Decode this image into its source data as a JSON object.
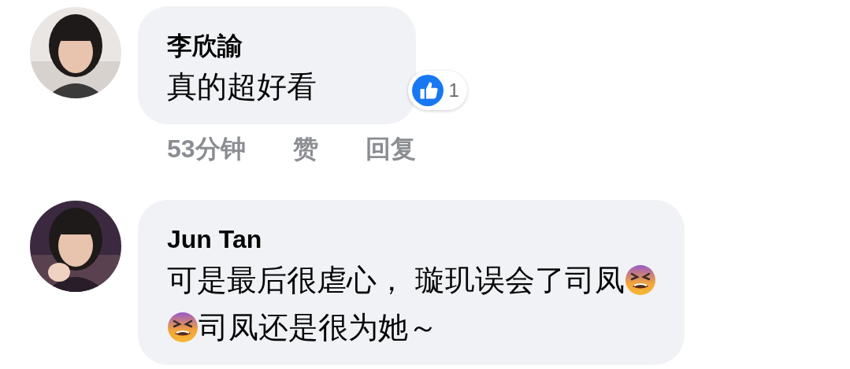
{
  "comments": [
    {
      "author": "李欣諭",
      "avatar": {
        "kind": "picture"
      },
      "lines": [
        [
          {
            "kind": "text",
            "text": "真的超好看"
          }
        ]
      ],
      "reaction": {
        "count": "1"
      },
      "actions": [
        "53分钟",
        "赞",
        "回复"
      ]
    },
    {
      "author": "Jun Tan",
      "avatar": {
        "kind": "picture"
      },
      "lines": [
        [
          {
            "kind": "text",
            "text": "可是最后很虐心， 璇玑误会了司凤"
          },
          {
            "kind": "emoji"
          }
        ],
        [
          {
            "kind": "emoji"
          },
          {
            "kind": "text",
            "text": "司凤还是很为她～"
          }
        ]
      ]
    }
  ]
}
